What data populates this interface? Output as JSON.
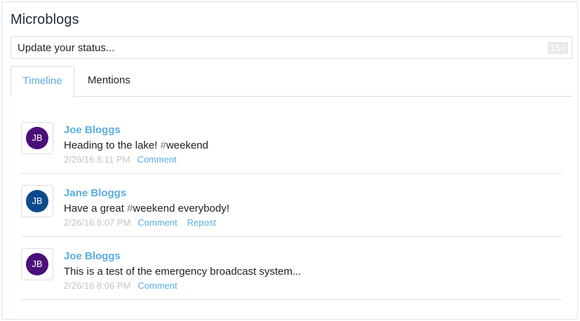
{
  "widget": {
    "title": "Microblogs"
  },
  "status": {
    "placeholder": "Update your status...",
    "remaining": "150"
  },
  "tabs": [
    {
      "label": "Timeline",
      "active": true
    },
    {
      "label": "Mentions",
      "active": false
    }
  ],
  "colors": {
    "accent": "#5aaee0",
    "avatar_joe": "#4b0f7a",
    "avatar_jane": "#0b4b8c"
  },
  "posts": [
    {
      "initials": "JB",
      "author": "Joe Bloggs",
      "text": "Heading to the lake! ",
      "hashtag_mark": "#",
      "hashtag_word": "weekend",
      "text_after": "",
      "time": "2/26/16 8:11 PM",
      "comment": "Comment"
    },
    {
      "initials": "JB",
      "author": "Jane Bloggs",
      "text": "Have a great ",
      "hashtag_mark": "#",
      "hashtag_word": "weekend",
      "text_after": " everybody!",
      "time": "2/26/16 8:07 PM",
      "comment": "Comment",
      "repost": "Repost"
    },
    {
      "initials": "JB",
      "author": "Joe Bloggs",
      "text": "This is a test of the emergency broadcast system...",
      "time": "2/26/16 8:06 PM",
      "comment": "Comment"
    }
  ]
}
